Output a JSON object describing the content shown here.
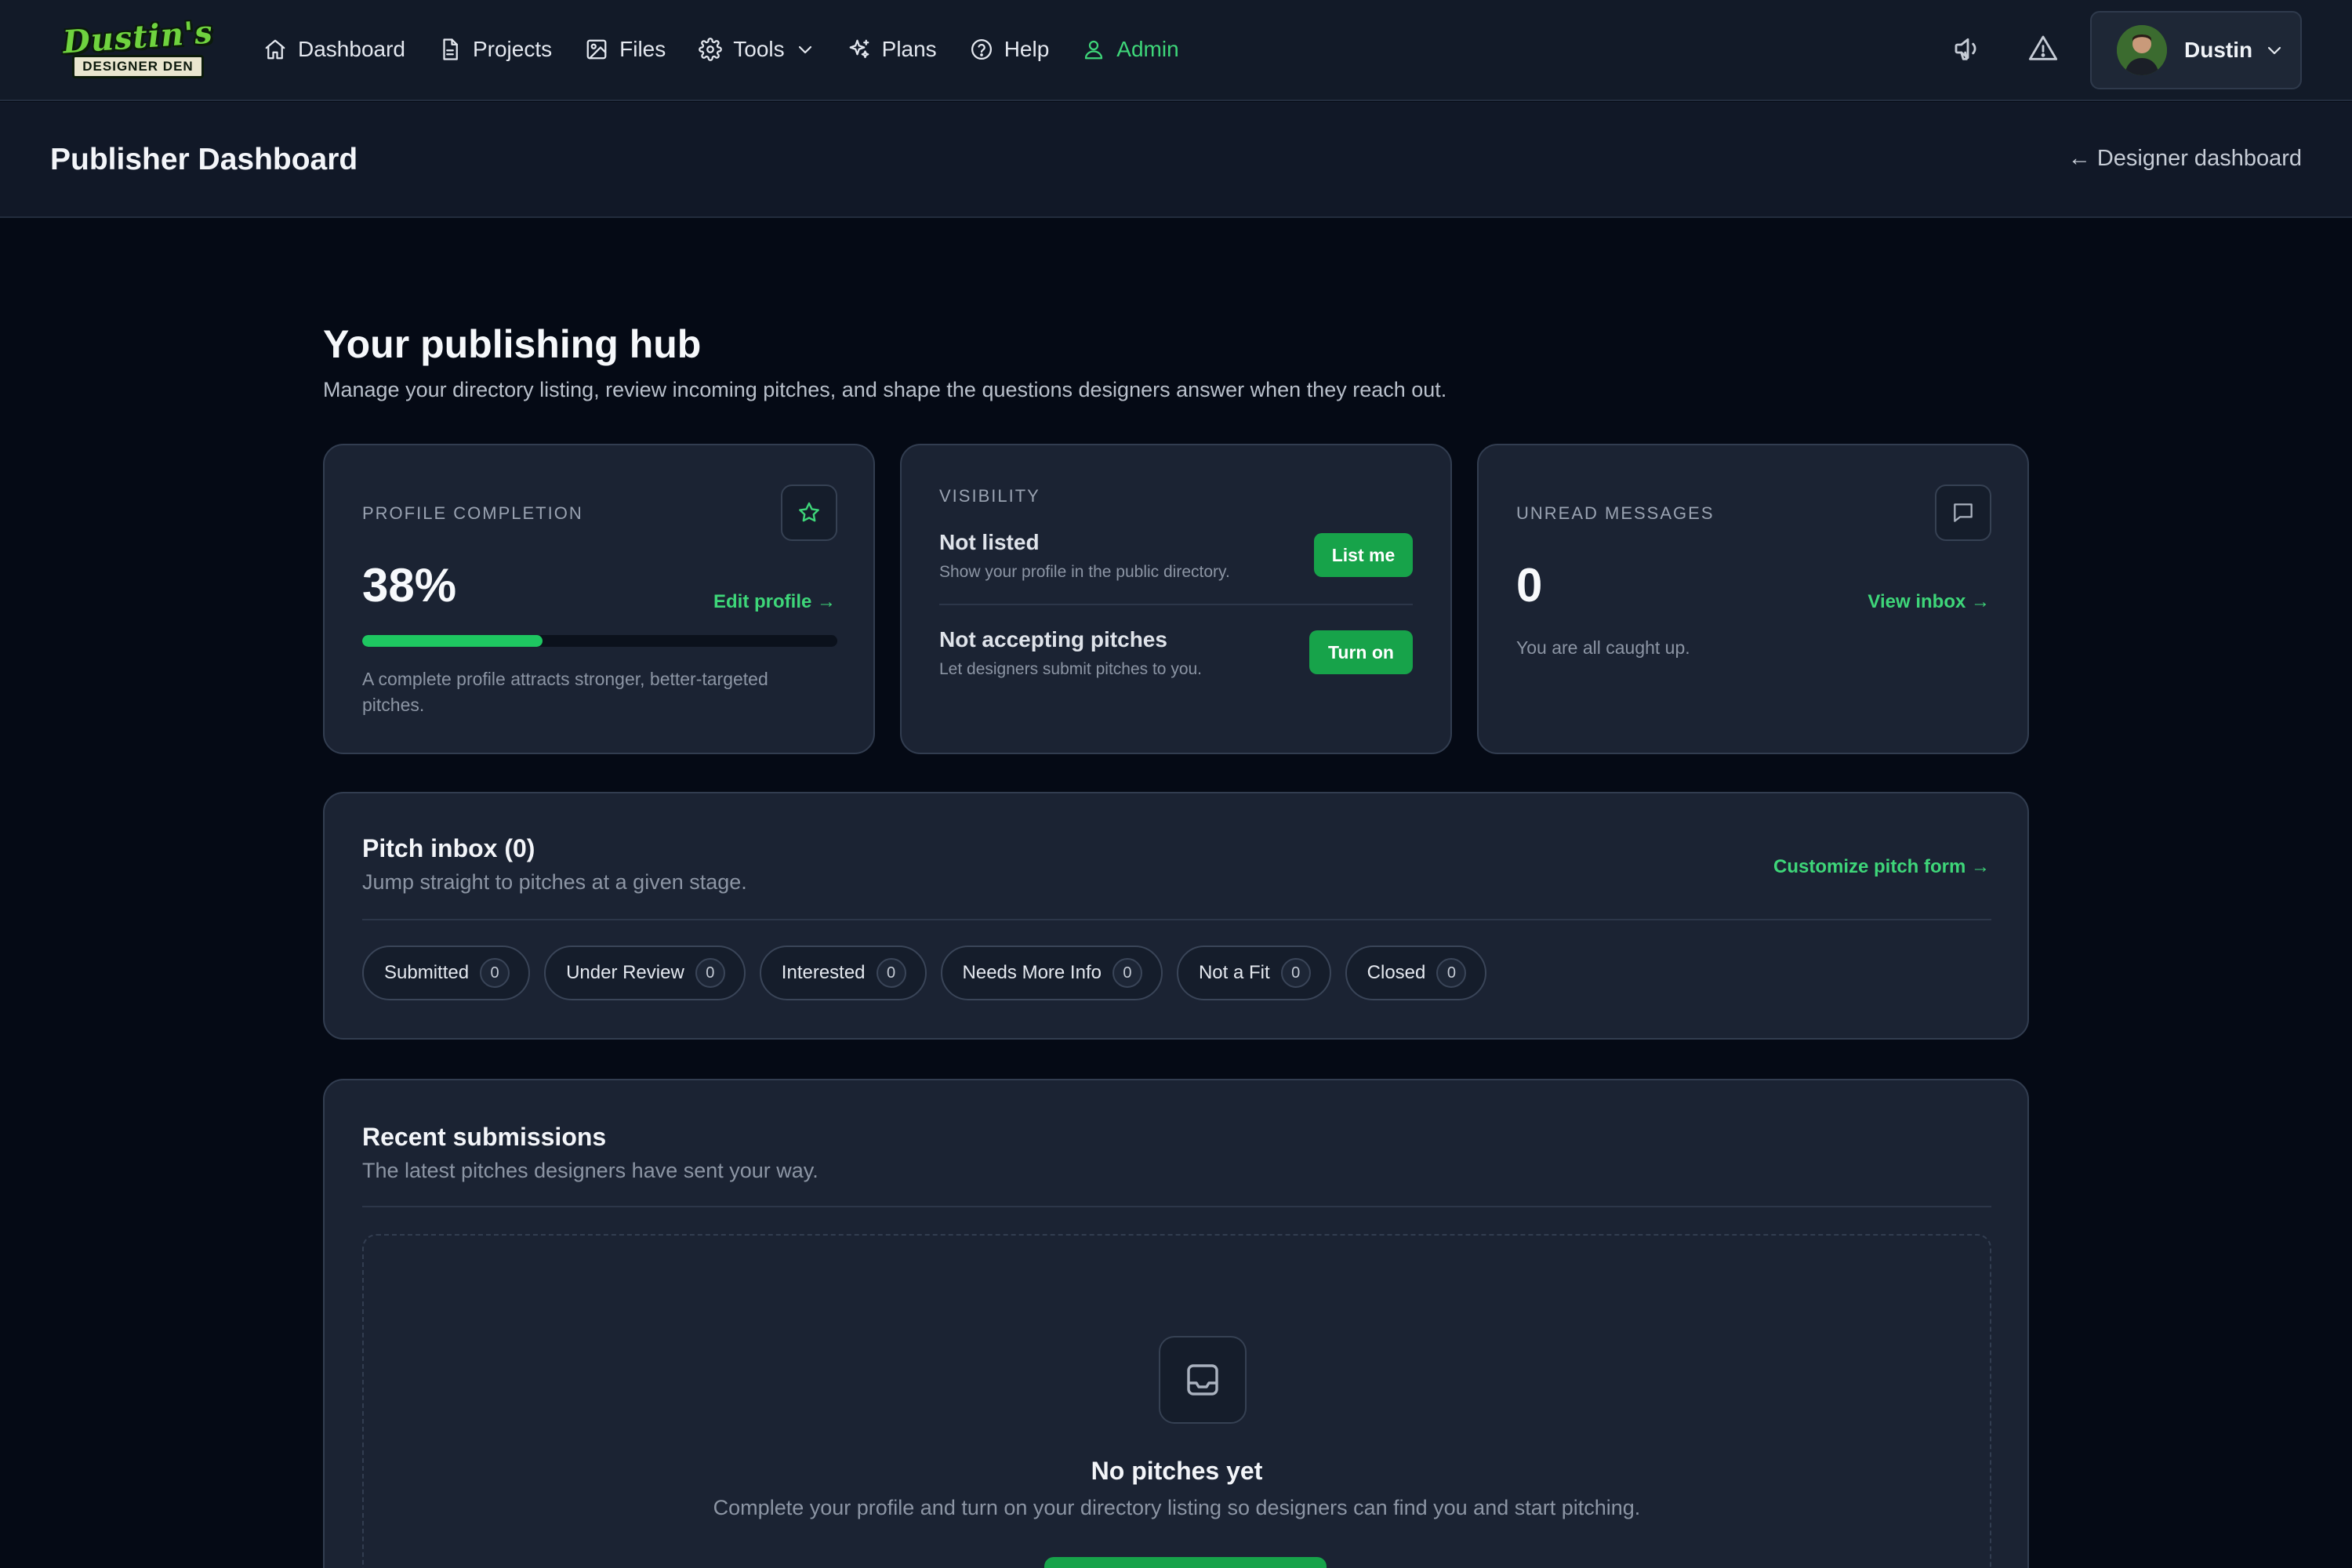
{
  "brand": {
    "line1": "Dustin's",
    "line2": "DESIGNER DEN"
  },
  "nav": {
    "items": [
      {
        "label": "Dashboard",
        "icon": "home-icon"
      },
      {
        "label": "Projects",
        "icon": "document-icon"
      },
      {
        "label": "Files",
        "icon": "image-icon"
      },
      {
        "label": "Tools",
        "icon": "gear-icon"
      },
      {
        "label": "Plans",
        "icon": "sparkles-icon"
      },
      {
        "label": "Help",
        "icon": "help-circle-icon"
      },
      {
        "label": "Admin",
        "icon": "user-icon"
      }
    ],
    "active": "Admin",
    "accent": "#3ed679"
  },
  "user": {
    "name": "Dustin"
  },
  "header": {
    "title": "Publisher Dashboard",
    "back_link": "← Designer dashboard"
  },
  "hub": {
    "title": "Your publishing hub",
    "subtitle": "Manage your directory listing, review incoming pitches, and shape the questions designers answer when they reach out."
  },
  "profile_card": {
    "label": "PROFILE COMPLETION",
    "value": "38%",
    "progress_percent": 38,
    "link": "Edit profile →",
    "note": "A complete profile attracts stronger, better-targeted pitches."
  },
  "visibility_card": {
    "label": "VISIBILITY",
    "listing": {
      "title": "Not listed",
      "desc": "Show your profile in the public directory.",
      "button": "List me"
    },
    "pitches": {
      "title": "Not accepting pitches",
      "desc": "Let designers submit pitches to you.",
      "button": "Turn on"
    }
  },
  "messages_card": {
    "label": "UNREAD MESSAGES",
    "value": "0",
    "link": "View inbox →",
    "note": "You are all caught up."
  },
  "pitch_inbox": {
    "title": "Pitch inbox (0)",
    "subtitle": "Jump straight to pitches at a given stage.",
    "link": "Customize pitch form →",
    "stages": [
      {
        "label": "Submitted",
        "count": "0"
      },
      {
        "label": "Under Review",
        "count": "0"
      },
      {
        "label": "Interested",
        "count": "0"
      },
      {
        "label": "Needs More Info",
        "count": "0"
      },
      {
        "label": "Not a Fit",
        "count": "0"
      },
      {
        "label": "Closed",
        "count": "0"
      }
    ]
  },
  "recent": {
    "title": "Recent submissions",
    "subtitle": "The latest pitches designers have sent your way.",
    "empty_title": "No pitches yet",
    "empty_text": "Complete your profile and turn on your directory listing so designers can find you and start pitching."
  }
}
